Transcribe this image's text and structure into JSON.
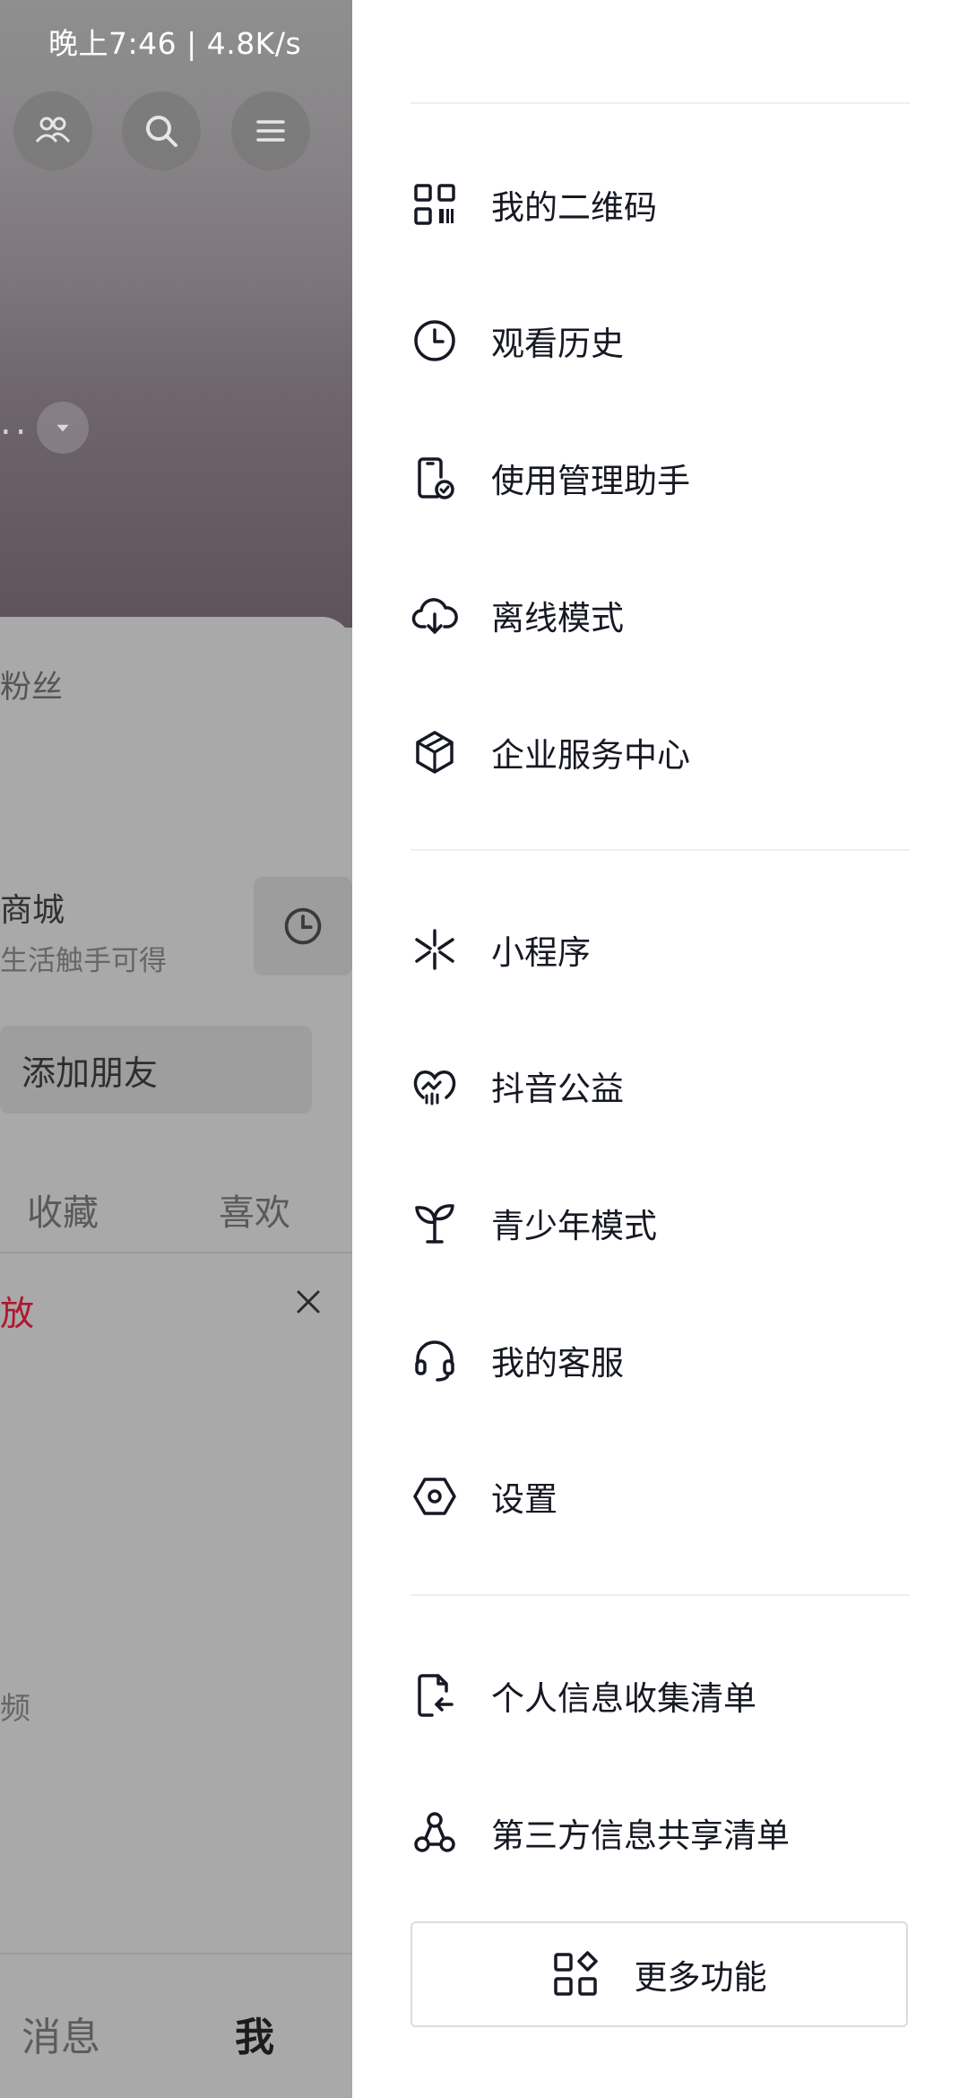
{
  "status_bar": {
    "time_and_speed": "晚上7:46 | 4.8K/s"
  },
  "background_page": {
    "name_truncated": "..",
    "followers_label": "粉丝",
    "mall_title": "商城",
    "mall_subtitle": "生活触手可得",
    "add_friend_label": "添加朋友",
    "tabs": {
      "favorites": "收藏",
      "likes": "喜欢"
    },
    "notice_fragment": "放",
    "video_fragment": "频",
    "bottom_nav": {
      "messages": "消息",
      "me": "我"
    }
  },
  "drawer": {
    "groups": [
      [
        {
          "icon": "qr-code-icon",
          "label": "我的二维码"
        },
        {
          "icon": "clock-icon",
          "label": "观看历史"
        },
        {
          "icon": "phone-check-icon",
          "label": "使用管理助手"
        },
        {
          "icon": "cloud-download-icon",
          "label": "离线模式"
        },
        {
          "icon": "cube-icon",
          "label": "企业服务中心"
        }
      ],
      [
        {
          "icon": "mini-program-icon",
          "label": "小程序"
        },
        {
          "icon": "heart-hand-icon",
          "label": "抖音公益"
        },
        {
          "icon": "sprout-icon",
          "label": "青少年模式"
        },
        {
          "icon": "headset-icon",
          "label": "我的客服"
        },
        {
          "icon": "settings-hexagon-icon",
          "label": "设置"
        }
      ],
      [
        {
          "icon": "document-arrow-icon",
          "label": "个人信息收集清单"
        },
        {
          "icon": "share-circles-icon",
          "label": "第三方信息共享清单"
        }
      ]
    ],
    "more_button_label": "更多功能"
  }
}
